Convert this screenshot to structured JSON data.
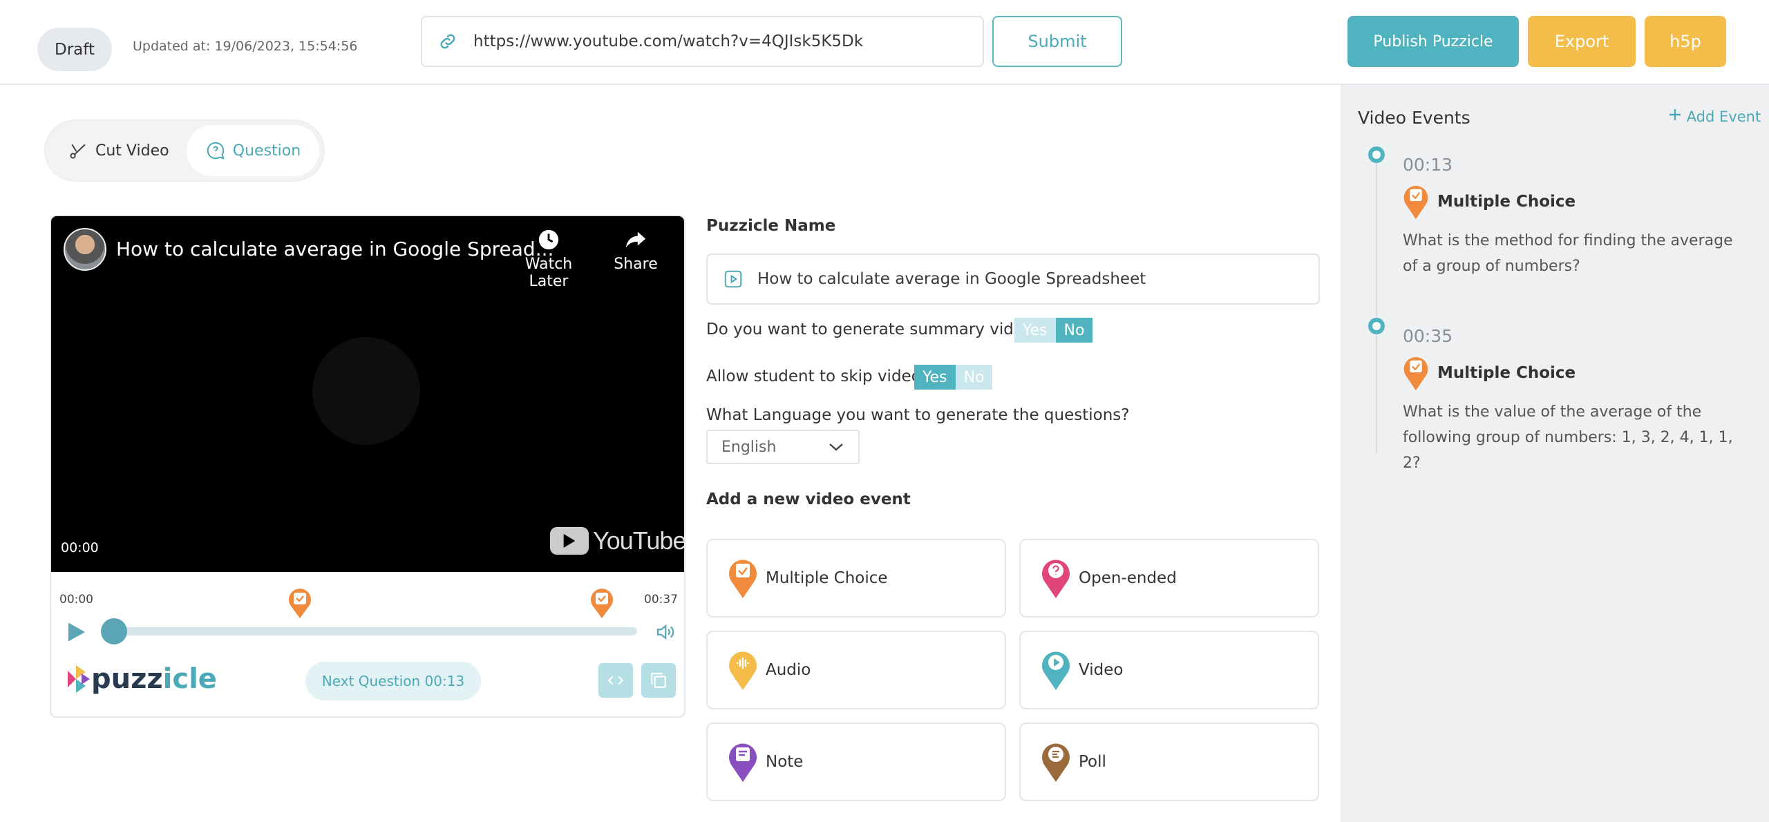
{
  "header": {
    "status": "Draft",
    "updated": "Updated at: 19/06/2023, 15:54:56",
    "url_value": "https://www.youtube.com/watch?v=4QJIsk5K5Dk",
    "submit": "Submit",
    "publish": "Publish Puzzicle",
    "export": "Export",
    "h5p": "h5p"
  },
  "tabs": {
    "cut": "Cut Video",
    "question": "Question"
  },
  "video": {
    "title": "How to calculate average in Google Spread...",
    "watch_later": "Watch Later",
    "share": "Share",
    "time": "00:00",
    "youtube": "YouTube"
  },
  "player": {
    "start": "00:00",
    "end": "00:37",
    "next_question": "Next Question 00:13",
    "logo_main": "puzz",
    "logo_accent": "icle"
  },
  "form": {
    "name_label": "Puzzicle Name",
    "name_value": "How to calculate average in Google Spreadsheet",
    "summary_q": "Do you want to generate summary video?",
    "skip_q": "Allow student to skip video?",
    "yes": "Yes",
    "no": "No",
    "lang_q": "What Language you want to generate the questions?",
    "lang_value": "English",
    "add_event": "Add a new video event"
  },
  "event_types": [
    "Multiple Choice",
    "Open-ended",
    "Audio",
    "Video",
    "Note",
    "Poll"
  ],
  "panel": {
    "title": "Video Events",
    "add": "Add Event",
    "events": [
      {
        "time": "00:13",
        "type": "Multiple Choice",
        "question": "What is the method for finding the average of a group of numbers?"
      },
      {
        "time": "00:35",
        "type": "Multiple Choice",
        "question": "What is the value of the average of the following group of numbers: 1, 3, 2, 4, 1, 1, 2?"
      }
    ]
  },
  "colors": {
    "teal": "#4fb3c0",
    "yellow": "#f4bd4a",
    "orange": "#f08a3c",
    "pink": "#e0457b",
    "purple": "#8a4fbf",
    "brown": "#9a6a3a"
  }
}
